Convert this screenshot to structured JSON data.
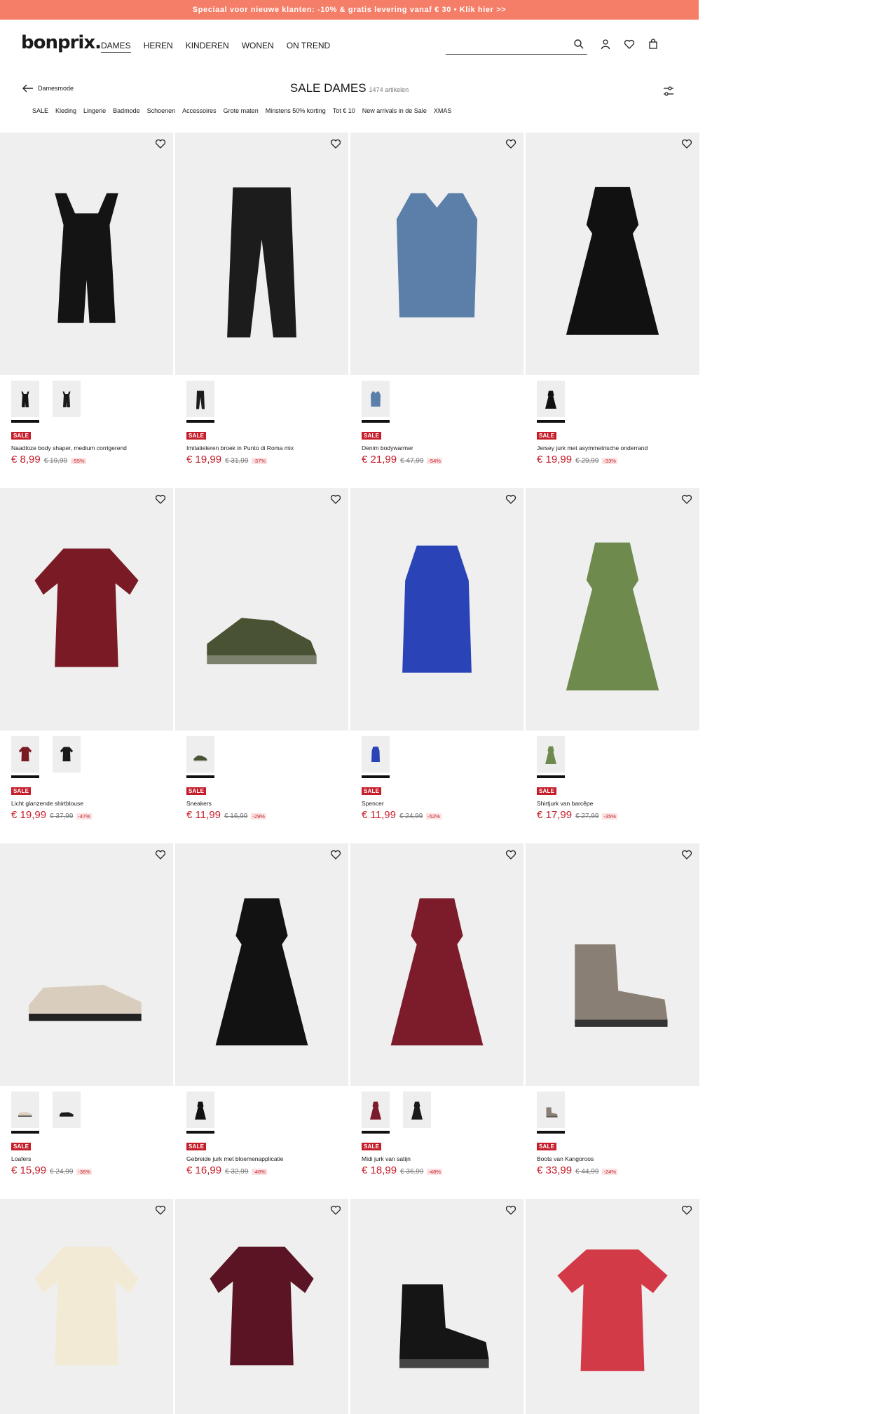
{
  "promo": {
    "text": "Speciaal voor nieuwe klanten: -10% & gratis levering vanaf € 30 • Klik hier >>"
  },
  "header": {
    "logo": "bonprix.",
    "nav": [
      "DAMES",
      "HEREN",
      "KINDEREN",
      "WONEN",
      "ON TREND"
    ],
    "active_nav": "DAMES",
    "search_value": ""
  },
  "category": {
    "back_label": "Damesmode",
    "title": "SALE DAMES",
    "count": "1474 artikelen",
    "subnav": [
      "SALE",
      "Kleding",
      "Lingerie",
      "Badmode",
      "Schoenen",
      "Accessoires",
      "Grote maten",
      "Minstens 50% korting",
      "Tot € 10",
      "New arrivals in de Sale",
      "XMAS"
    ]
  },
  "colors": {
    "promo": "#f47e68",
    "sale_red": "#c51e2a"
  },
  "products": [
    {
      "name": "Naadloze body shaper, medium corrigerend",
      "price": "€ 8,99",
      "old_price": "€ 19,99",
      "discount": "-55%",
      "badge": "SALE",
      "thumbs": 2,
      "icon": "bodysuit-icon",
      "color": "#141414"
    },
    {
      "name": "Imitatieleren broek in Punto di Roma mix",
      "price": "€ 19,99",
      "old_price": "€ 31,99",
      "discount": "-37%",
      "badge": "SALE",
      "thumbs": 1,
      "icon": "trousers-icon",
      "color": "#1c1c1c"
    },
    {
      "name": "Denim bodywarmer",
      "price": "€ 21,99",
      "old_price": "€ 47,99",
      "discount": "-54%",
      "badge": "SALE",
      "thumbs": 1,
      "icon": "vest-icon",
      "color": "#5b7fa8"
    },
    {
      "name": "Jersey jurk met asymmetrische onderrand",
      "price": "€ 19,99",
      "old_price": "€ 29,99",
      "discount": "-33%",
      "badge": "SALE",
      "thumbs": 1,
      "icon": "dress-icon",
      "color": "#111111"
    },
    {
      "name": "Licht glanzende shirtblouse",
      "price": "€ 19,99",
      "old_price": "€ 37,99",
      "discount": "-47%",
      "badge": "SALE",
      "thumbs": 2,
      "icon": "blouse-icon",
      "color": "#7a1a24"
    },
    {
      "name": "Sneakers",
      "price": "€ 11,99",
      "old_price": "€ 16,99",
      "discount": "-29%",
      "badge": "SALE",
      "thumbs": 1,
      "icon": "sneaker-icon",
      "color": "#4a5234"
    },
    {
      "name": "Spencer",
      "price": "€ 11,99",
      "old_price": "€ 24,99",
      "discount": "-52%",
      "badge": "SALE",
      "thumbs": 1,
      "icon": "tanktop-icon",
      "color": "#2a44b8"
    },
    {
      "name": "Shirtjurk van barcêpe",
      "price": "€ 17,99",
      "old_price": "€ 27,99",
      "discount": "-35%",
      "badge": "SALE",
      "thumbs": 1,
      "icon": "dress-icon",
      "color": "#6e8a4c"
    },
    {
      "name": "Loafers",
      "price": "€ 15,99",
      "old_price": "€ 24,99",
      "discount": "-36%",
      "badge": "SALE",
      "thumbs": 2,
      "icon": "loafer-icon",
      "color": "#d9cdbd"
    },
    {
      "name": "Gebreide jurk met bloemenapplicatie",
      "price": "€ 16,99",
      "old_price": "€ 32,99",
      "discount": "-48%",
      "badge": "SALE",
      "thumbs": 1,
      "icon": "dress-icon",
      "color": "#121212"
    },
    {
      "name": "Midi jurk van satijn",
      "price": "€ 18,99",
      "old_price": "€ 36,99",
      "discount": "-48%",
      "badge": "SALE",
      "thumbs": 2,
      "icon": "dress-icon",
      "color": "#7c1c2a"
    },
    {
      "name": "Boots van Kangoroos",
      "price": "€ 33,99",
      "old_price": "€ 44,99",
      "discount": "-24%",
      "badge": "SALE",
      "thumbs": 1,
      "icon": "boot-icon",
      "color": "#8a7f74"
    }
  ],
  "last_row": [
    {
      "icon": "blouse-icon",
      "color": "#f3ead6"
    },
    {
      "icon": "blouse-icon",
      "color": "#5a1424"
    },
    {
      "icon": "sneaker-boot-icon",
      "color": "#151515"
    },
    {
      "icon": "tshirt-icon",
      "color": "#d33a48"
    }
  ]
}
